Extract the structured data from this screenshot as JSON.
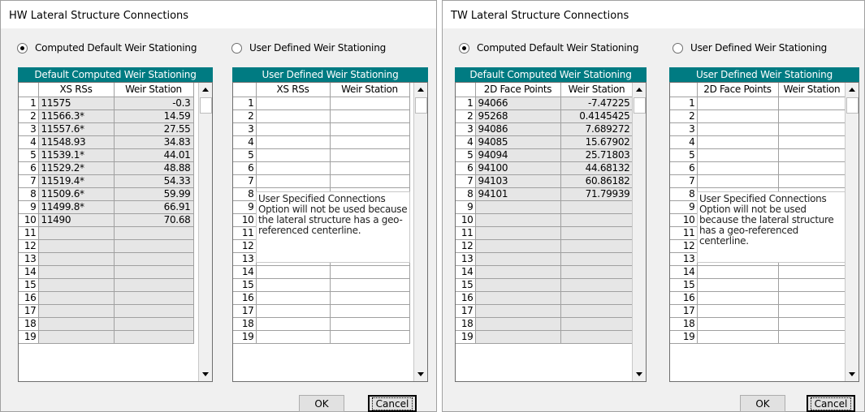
{
  "hw": {
    "title": "HW Lateral Structure Connections",
    "radio_computed": "Computed Default Weir Stationing",
    "radio_user": "User Defined Weir Stationing",
    "computed_header": "Default Computed Weir Stationing",
    "computed_col1": "XS RSs",
    "computed_col2": "Weir Station",
    "user_header": "User Defined Weir Stationing",
    "user_col1": "XS RSs",
    "user_col2": "Weir Station",
    "rows": [
      {
        "n": "1",
        "a": "11575",
        "b": "-0.3"
      },
      {
        "n": "2",
        "a": "11566.3*",
        "b": "14.59"
      },
      {
        "n": "3",
        "a": "11557.6*",
        "b": "27.55"
      },
      {
        "n": "4",
        "a": "11548.93",
        "b": "34.83"
      },
      {
        "n": "5",
        "a": "11539.1*",
        "b": "44.01"
      },
      {
        "n": "6",
        "a": "11529.2*",
        "b": "48.88"
      },
      {
        "n": "7",
        "a": "11519.4*",
        "b": "54.33"
      },
      {
        "n": "8",
        "a": "11509.6*",
        "b": "59.99"
      },
      {
        "n": "9",
        "a": "11499.8*",
        "b": "66.91"
      },
      {
        "n": "10",
        "a": "11490",
        "b": "70.68"
      },
      {
        "n": "11",
        "a": "",
        "b": ""
      },
      {
        "n": "12",
        "a": "",
        "b": ""
      },
      {
        "n": "13",
        "a": "",
        "b": ""
      },
      {
        "n": "14",
        "a": "",
        "b": ""
      },
      {
        "n": "15",
        "a": "",
        "b": ""
      },
      {
        "n": "16",
        "a": "",
        "b": ""
      },
      {
        "n": "17",
        "a": "",
        "b": ""
      },
      {
        "n": "18",
        "a": "",
        "b": ""
      },
      {
        "n": "19",
        "a": "",
        "b": ""
      }
    ],
    "note": "User Specified Connections Option will not be used because the lateral structure has a geo-referenced centerline.",
    "ok": "OK",
    "cancel": "Cancel"
  },
  "tw": {
    "title": "TW Lateral Structure Connections",
    "radio_computed": "Computed Default Weir Stationing",
    "radio_user": "User Defined Weir Stationing",
    "computed_header": "Default Computed Weir Stationing",
    "computed_col1": "2D Face Points",
    "computed_col2": "Weir Station",
    "user_header": "User Defined Weir Stationing",
    "user_col1": "2D Face Points",
    "user_col2": "Weir Station",
    "rows": [
      {
        "n": "1",
        "a": "94066",
        "b": "-7.47225"
      },
      {
        "n": "2",
        "a": "95268",
        "b": "0.4145425"
      },
      {
        "n": "3",
        "a": "94086",
        "b": "7.689272"
      },
      {
        "n": "4",
        "a": "94085",
        "b": "15.67902"
      },
      {
        "n": "5",
        "a": "94094",
        "b": "25.71803"
      },
      {
        "n": "6",
        "a": "94100",
        "b": "44.68132"
      },
      {
        "n": "7",
        "a": "94103",
        "b": "60.86182"
      },
      {
        "n": "8",
        "a": "94101",
        "b": "71.79939"
      },
      {
        "n": "9",
        "a": "",
        "b": ""
      },
      {
        "n": "10",
        "a": "",
        "b": ""
      },
      {
        "n": "11",
        "a": "",
        "b": ""
      },
      {
        "n": "12",
        "a": "",
        "b": ""
      },
      {
        "n": "13",
        "a": "",
        "b": ""
      },
      {
        "n": "14",
        "a": "",
        "b": ""
      },
      {
        "n": "15",
        "a": "",
        "b": ""
      },
      {
        "n": "16",
        "a": "",
        "b": ""
      },
      {
        "n": "17",
        "a": "",
        "b": ""
      },
      {
        "n": "18",
        "a": "",
        "b": ""
      },
      {
        "n": "19",
        "a": "",
        "b": ""
      }
    ],
    "note": "User Specified Connections Option will not be used because the lateral structure has a geo-referenced centerline.",
    "ok": "OK",
    "cancel": "Cancel"
  },
  "colors": {
    "header_teal": "#007b82",
    "grid_line": "#a0a0a0",
    "readonly_cell": "#e6e6e6"
  }
}
